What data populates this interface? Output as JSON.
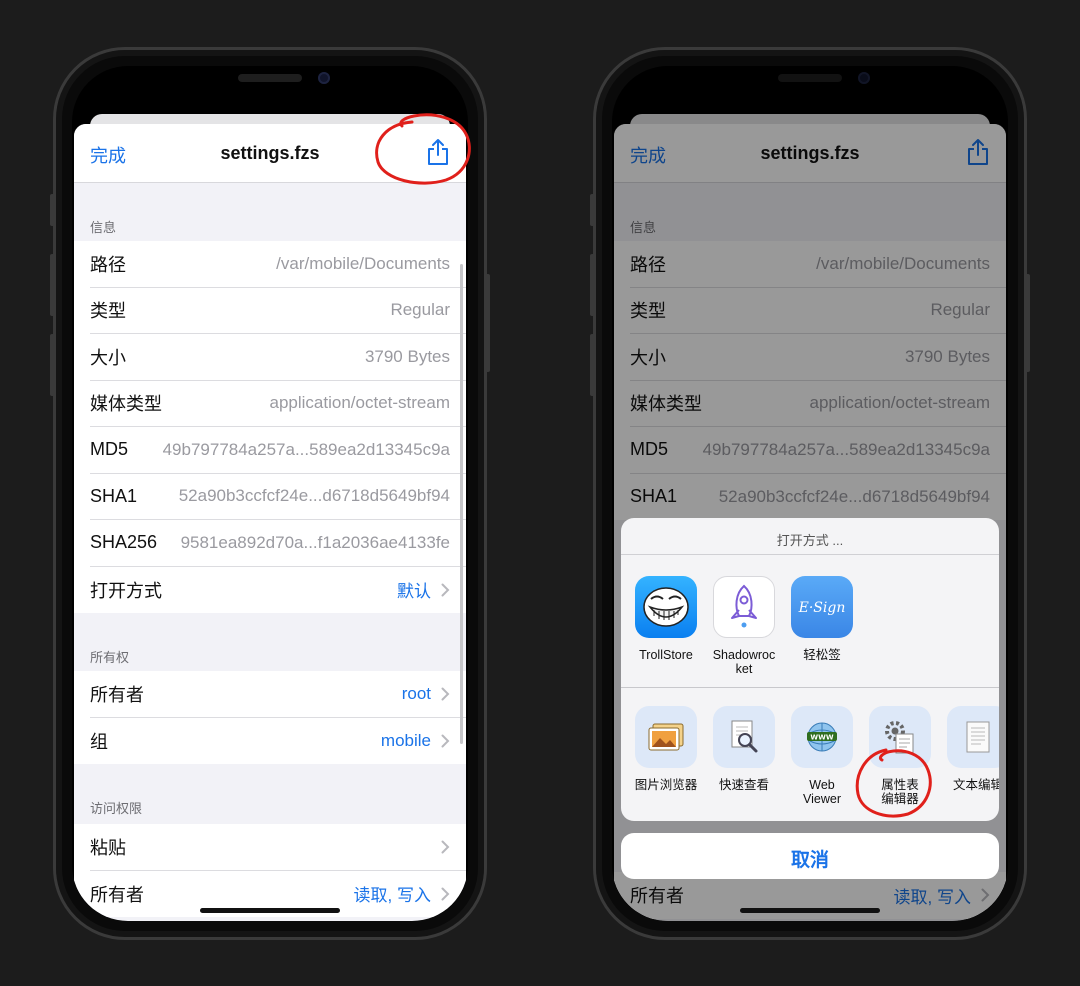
{
  "screens": [
    {
      "nav": {
        "done": "完成",
        "title": "settings.fzs"
      },
      "sections": [
        {
          "header": "信息",
          "rows": [
            {
              "label": "路径",
              "value": "/var/mobile/Documents"
            },
            {
              "label": "类型",
              "value": "Regular"
            },
            {
              "label": "大小",
              "value": "3790 Bytes"
            },
            {
              "label": "媒体类型",
              "value": "application/octet-stream"
            },
            {
              "label": "MD5",
              "value": "49b797784a257a...589ea2d13345c9a"
            },
            {
              "label": "SHA1",
              "value": "52a90b3ccfcf24e...d6718d5649bf94"
            },
            {
              "label": "SHA256",
              "value": "9581ea892d70a...f1a2036ae4133fe"
            },
            {
              "label": "打开方式",
              "value": "默认"
            }
          ]
        },
        {
          "header": "所有权",
          "rows": [
            {
              "label": "所有者",
              "value": "root"
            },
            {
              "label": "组",
              "value": "mobile"
            }
          ]
        },
        {
          "header": "访问权限",
          "rows": [
            {
              "label": "粘贴",
              "value": ""
            },
            {
              "label": "所有者",
              "value": "读取, 写入"
            }
          ]
        }
      ]
    },
    {
      "nav": {
        "done": "完成",
        "title": "settings.fzs"
      },
      "sections": [
        {
          "header": "信息",
          "rows": [
            {
              "label": "路径",
              "value": "/var/mobile/Documents"
            },
            {
              "label": "类型",
              "value": "Regular"
            },
            {
              "label": "大小",
              "value": "3790 Bytes"
            },
            {
              "label": "媒体类型",
              "value": "application/octet-stream"
            },
            {
              "label": "MD5",
              "value": "49b797784a257a...589ea2d13345c9a"
            },
            {
              "label": "SHA1",
              "value": "52a90b3ccfcf24e...d6718d5649bf94"
            }
          ]
        }
      ],
      "bottom_row": {
        "label": "所有者",
        "value": "读取, 写入"
      },
      "action_sheet": {
        "title": "打开方式 ...",
        "apps": [
          {
            "label": "TrollStore",
            "icon": "trollface-icon"
          },
          {
            "label": "Shadowrocket",
            "label_l1": "Shadowroc",
            "label_l2": "ket",
            "icon": "rocket-icon"
          },
          {
            "label": "轻松签",
            "icon": "esign-icon"
          }
        ],
        "tools": [
          {
            "label": "图片浏览器",
            "icon": "photo-icon"
          },
          {
            "label": "快速查看",
            "icon": "quicklook-icon"
          },
          {
            "label": "Web Viewer",
            "label_l1": "Web",
            "label_l2": "Viewer",
            "icon": "globe-icon"
          },
          {
            "label": "属性表编辑器",
            "label_l1": "属性表",
            "label_l2": "编辑器",
            "icon": "plist-icon"
          },
          {
            "label": "文本编辑",
            "icon": "text-doc-icon"
          }
        ],
        "cancel": "取消"
      }
    }
  ],
  "colors": {
    "accent": "#1a73e8",
    "annotation": "#e0201b",
    "background": "#1c1c1c"
  }
}
